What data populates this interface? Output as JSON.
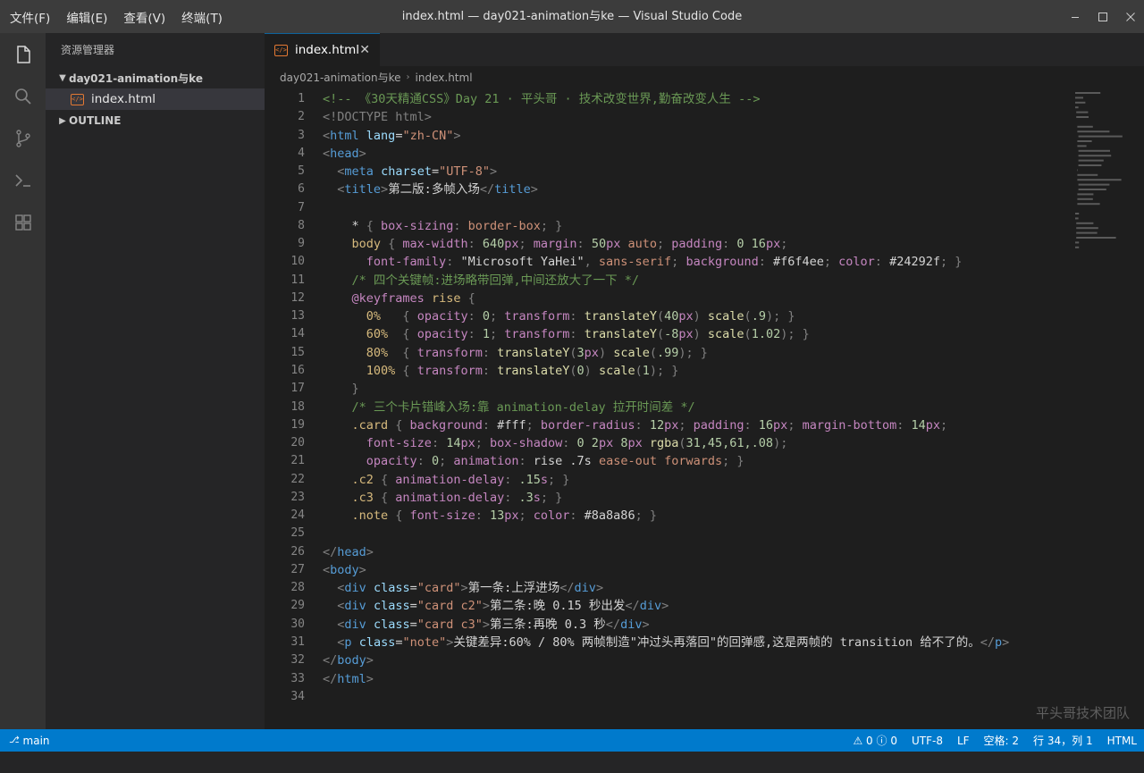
{
  "menu": [
    "文件(F)",
    "编辑(E)",
    "查看(V)",
    "终端(T)"
  ],
  "window_title": "index.html — day021-animation与ke — Visual Studio Code",
  "sidebar": {
    "title": "资源管理器",
    "folder": "day021-animation与ke",
    "file": "index.html",
    "outline": "OUTLINE"
  },
  "tab": {
    "label": "index.html"
  },
  "breadcrumb": {
    "folder": "day021-animation与ke",
    "file": "index.html"
  },
  "code_lines": [
    [
      [
        "#6a9955",
        "<!-- 《30天精通CSS》Day 21 · 平头哥 · 技术改变世界,勤奋改变人生 -->"
      ]
    ],
    [
      [
        "#808080",
        "<!DOCTYPE html>"
      ]
    ],
    [
      [
        "#808080",
        "<"
      ],
      [
        "#569cd6",
        "html"
      ],
      [
        "#d4d4d4",
        " "
      ],
      [
        "#9cdcfe",
        "lang"
      ],
      [
        "#d4d4d4",
        "="
      ],
      [
        "#ce9178",
        "\"zh-CN\""
      ],
      [
        "#808080",
        ">"
      ]
    ],
    [
      [
        "#808080",
        "<"
      ],
      [
        "#569cd6",
        "head"
      ],
      [
        "#808080",
        ">"
      ]
    ],
    [
      [
        "#d4d4d4",
        "  "
      ],
      [
        "#808080",
        "<"
      ],
      [
        "#569cd6",
        "meta"
      ],
      [
        "#d4d4d4",
        " "
      ],
      [
        "#9cdcfe",
        "charset"
      ],
      [
        "#d4d4d4",
        "="
      ],
      [
        "#ce9178",
        "\"UTF-8\""
      ],
      [
        "#808080",
        ">"
      ]
    ],
    [
      [
        "#d4d4d4",
        "  "
      ],
      [
        "#808080",
        "<"
      ],
      [
        "#569cd6",
        "title"
      ],
      [
        "#808080",
        ">"
      ],
      [
        "#d4d4d4",
        "第二版:多帧入场"
      ],
      [
        "#808080",
        "</"
      ],
      [
        "#569cd6",
        "title"
      ],
      [
        "#808080",
        ">"
      ]
    ],
    [],
    [
      [
        "#d4d4d4",
        "    * "
      ],
      [
        "#808080",
        "{ "
      ],
      [
        "#c586c0",
        "box-sizing"
      ],
      [
        "#808080",
        ": "
      ],
      [
        "#ce9178",
        "border-box"
      ],
      [
        "#808080",
        "; }"
      ]
    ],
    [
      [
        "#d4d4d4",
        "    "
      ],
      [
        "#d7ba7d",
        "body"
      ],
      [
        "#808080",
        " { "
      ],
      [
        "#c586c0",
        "max-width"
      ],
      [
        "#808080",
        ": "
      ],
      [
        "#b5cea8",
        "640"
      ],
      [
        "#c586c0",
        "px"
      ],
      [
        "#808080",
        "; "
      ],
      [
        "#c586c0",
        "margin"
      ],
      [
        "#808080",
        ": "
      ],
      [
        "#b5cea8",
        "50"
      ],
      [
        "#c586c0",
        "px"
      ],
      [
        "#ce9178",
        " auto"
      ],
      [
        "#808080",
        "; "
      ],
      [
        "#c586c0",
        "padding"
      ],
      [
        "#808080",
        ": "
      ],
      [
        "#b5cea8",
        "0 16"
      ],
      [
        "#c586c0",
        "px"
      ],
      [
        "#808080",
        ";"
      ]
    ],
    [
      [
        "#d4d4d4",
        "      "
      ],
      [
        "#c586c0",
        "font-family"
      ],
      [
        "#808080",
        ": "
      ],
      [
        "#d4d4d4",
        "\"Microsoft YaHei\""
      ],
      [
        "#808080",
        ", "
      ],
      [
        "#ce9178",
        "sans-serif"
      ],
      [
        "#808080",
        "; "
      ],
      [
        "#c586c0",
        "background"
      ],
      [
        "#808080",
        ": "
      ],
      [
        "#d4d4d4",
        "#f6f4ee"
      ],
      [
        "#808080",
        "; "
      ],
      [
        "#c586c0",
        "color"
      ],
      [
        "#808080",
        ": "
      ],
      [
        "#d4d4d4",
        "#24292f"
      ],
      [
        "#808080",
        "; }"
      ]
    ],
    [
      [
        "#d4d4d4",
        "    "
      ],
      [
        "#6a9955",
        "/* 四个关键帧:进场略带回弹,中间还放大了一下 */"
      ]
    ],
    [
      [
        "#d4d4d4",
        "    "
      ],
      [
        "#c586c0",
        "@keyframes"
      ],
      [
        "#d4d4d4",
        " "
      ],
      [
        "#d7ba7d",
        "rise"
      ],
      [
        "#808080",
        " {"
      ]
    ],
    [
      [
        "#d4d4d4",
        "      "
      ],
      [
        "#d7ba7d",
        "0%"
      ],
      [
        "#808080",
        "   { "
      ],
      [
        "#c586c0",
        "opacity"
      ],
      [
        "#808080",
        ": "
      ],
      [
        "#b5cea8",
        "0"
      ],
      [
        "#808080",
        "; "
      ],
      [
        "#c586c0",
        "transform"
      ],
      [
        "#808080",
        ": "
      ],
      [
        "#dcdcaa",
        "translateY"
      ],
      [
        "#808080",
        "("
      ],
      [
        "#b5cea8",
        "40"
      ],
      [
        "#c586c0",
        "px"
      ],
      [
        "#808080",
        ") "
      ],
      [
        "#dcdcaa",
        "scale"
      ],
      [
        "#808080",
        "("
      ],
      [
        "#b5cea8",
        ".9"
      ],
      [
        "#808080",
        "); }"
      ]
    ],
    [
      [
        "#d4d4d4",
        "      "
      ],
      [
        "#d7ba7d",
        "60%"
      ],
      [
        "#808080",
        "  { "
      ],
      [
        "#c586c0",
        "opacity"
      ],
      [
        "#808080",
        ": "
      ],
      [
        "#b5cea8",
        "1"
      ],
      [
        "#808080",
        "; "
      ],
      [
        "#c586c0",
        "transform"
      ],
      [
        "#808080",
        ": "
      ],
      [
        "#dcdcaa",
        "translateY"
      ],
      [
        "#808080",
        "("
      ],
      [
        "#b5cea8",
        "-8"
      ],
      [
        "#c586c0",
        "px"
      ],
      [
        "#808080",
        ") "
      ],
      [
        "#dcdcaa",
        "scale"
      ],
      [
        "#808080",
        "("
      ],
      [
        "#b5cea8",
        "1.02"
      ],
      [
        "#808080",
        "); }"
      ]
    ],
    [
      [
        "#d4d4d4",
        "      "
      ],
      [
        "#d7ba7d",
        "80%"
      ],
      [
        "#808080",
        "  { "
      ],
      [
        "#c586c0",
        "transform"
      ],
      [
        "#808080",
        ": "
      ],
      [
        "#dcdcaa",
        "translateY"
      ],
      [
        "#808080",
        "("
      ],
      [
        "#b5cea8",
        "3"
      ],
      [
        "#c586c0",
        "px"
      ],
      [
        "#808080",
        ") "
      ],
      [
        "#dcdcaa",
        "scale"
      ],
      [
        "#808080",
        "("
      ],
      [
        "#b5cea8",
        ".99"
      ],
      [
        "#808080",
        "); }"
      ]
    ],
    [
      [
        "#d4d4d4",
        "      "
      ],
      [
        "#d7ba7d",
        "100%"
      ],
      [
        "#808080",
        " { "
      ],
      [
        "#c586c0",
        "transform"
      ],
      [
        "#808080",
        ": "
      ],
      [
        "#dcdcaa",
        "translateY"
      ],
      [
        "#808080",
        "("
      ],
      [
        "#b5cea8",
        "0"
      ],
      [
        "#808080",
        ") "
      ],
      [
        "#dcdcaa",
        "scale"
      ],
      [
        "#808080",
        "("
      ],
      [
        "#b5cea8",
        "1"
      ],
      [
        "#808080",
        "); }"
      ]
    ],
    [
      [
        "#808080",
        "    }"
      ]
    ],
    [
      [
        "#d4d4d4",
        "    "
      ],
      [
        "#6a9955",
        "/* 三个卡片错峰入场:靠 animation-delay 拉开时间差 */"
      ]
    ],
    [
      [
        "#d4d4d4",
        "    "
      ],
      [
        "#d7ba7d",
        ".card"
      ],
      [
        "#808080",
        " { "
      ],
      [
        "#c586c0",
        "background"
      ],
      [
        "#808080",
        ": "
      ],
      [
        "#d4d4d4",
        "#fff"
      ],
      [
        "#808080",
        "; "
      ],
      [
        "#c586c0",
        "border-radius"
      ],
      [
        "#808080",
        ": "
      ],
      [
        "#b5cea8",
        "12"
      ],
      [
        "#c586c0",
        "px"
      ],
      [
        "#808080",
        "; "
      ],
      [
        "#c586c0",
        "padding"
      ],
      [
        "#808080",
        ": "
      ],
      [
        "#b5cea8",
        "16"
      ],
      [
        "#c586c0",
        "px"
      ],
      [
        "#808080",
        "; "
      ],
      [
        "#c586c0",
        "margin-bottom"
      ],
      [
        "#808080",
        ": "
      ],
      [
        "#b5cea8",
        "14"
      ],
      [
        "#c586c0",
        "px"
      ],
      [
        "#808080",
        ";"
      ]
    ],
    [
      [
        "#d4d4d4",
        "      "
      ],
      [
        "#c586c0",
        "font-size"
      ],
      [
        "#808080",
        ": "
      ],
      [
        "#b5cea8",
        "14"
      ],
      [
        "#c586c0",
        "px"
      ],
      [
        "#808080",
        "; "
      ],
      [
        "#c586c0",
        "box-shadow"
      ],
      [
        "#808080",
        ": "
      ],
      [
        "#b5cea8",
        "0 2"
      ],
      [
        "#c586c0",
        "px"
      ],
      [
        "#b5cea8",
        " 8"
      ],
      [
        "#c586c0",
        "px"
      ],
      [
        "#d4d4d4",
        " "
      ],
      [
        "#dcdcaa",
        "rgba"
      ],
      [
        "#808080",
        "("
      ],
      [
        "#b5cea8",
        "31,45,61,.08"
      ],
      [
        "#808080",
        ");"
      ]
    ],
    [
      [
        "#d4d4d4",
        "      "
      ],
      [
        "#c586c0",
        "opacity"
      ],
      [
        "#808080",
        ": "
      ],
      [
        "#b5cea8",
        "0"
      ],
      [
        "#808080",
        "; "
      ],
      [
        "#c586c0",
        "animation"
      ],
      [
        "#808080",
        ": "
      ],
      [
        "#d4d4d4",
        "rise .7s "
      ],
      [
        "#ce9178",
        "ease-out forwards"
      ],
      [
        "#808080",
        "; }"
      ]
    ],
    [
      [
        "#d4d4d4",
        "    "
      ],
      [
        "#d7ba7d",
        ".c2"
      ],
      [
        "#808080",
        " { "
      ],
      [
        "#c586c0",
        "animation-delay"
      ],
      [
        "#808080",
        ": "
      ],
      [
        "#b5cea8",
        ".15"
      ],
      [
        "#c586c0",
        "s"
      ],
      [
        "#808080",
        "; }"
      ]
    ],
    [
      [
        "#d4d4d4",
        "    "
      ],
      [
        "#d7ba7d",
        ".c3"
      ],
      [
        "#808080",
        " { "
      ],
      [
        "#c586c0",
        "animation-delay"
      ],
      [
        "#808080",
        ": "
      ],
      [
        "#b5cea8",
        ".3"
      ],
      [
        "#c586c0",
        "s"
      ],
      [
        "#808080",
        "; }"
      ]
    ],
    [
      [
        "#d4d4d4",
        "    "
      ],
      [
        "#d7ba7d",
        ".note"
      ],
      [
        "#808080",
        " { "
      ],
      [
        "#c586c0",
        "font-size"
      ],
      [
        "#808080",
        ": "
      ],
      [
        "#b5cea8",
        "13"
      ],
      [
        "#c586c0",
        "px"
      ],
      [
        "#808080",
        "; "
      ],
      [
        "#c586c0",
        "color"
      ],
      [
        "#808080",
        ": "
      ],
      [
        "#d4d4d4",
        "#8a8a86"
      ],
      [
        "#808080",
        "; }"
      ]
    ],
    [],
    [
      [
        "#808080",
        "</"
      ],
      [
        "#569cd6",
        "head"
      ],
      [
        "#808080",
        ">"
      ]
    ],
    [
      [
        "#808080",
        "<"
      ],
      [
        "#569cd6",
        "body"
      ],
      [
        "#808080",
        ">"
      ]
    ],
    [
      [
        "#d4d4d4",
        "  "
      ],
      [
        "#808080",
        "<"
      ],
      [
        "#569cd6",
        "div"
      ],
      [
        "#d4d4d4",
        " "
      ],
      [
        "#9cdcfe",
        "class"
      ],
      [
        "#d4d4d4",
        "="
      ],
      [
        "#ce9178",
        "\"card\""
      ],
      [
        "#808080",
        ">"
      ],
      [
        "#d4d4d4",
        "第一条:上浮进场"
      ],
      [
        "#808080",
        "</"
      ],
      [
        "#569cd6",
        "div"
      ],
      [
        "#808080",
        ">"
      ]
    ],
    [
      [
        "#d4d4d4",
        "  "
      ],
      [
        "#808080",
        "<"
      ],
      [
        "#569cd6",
        "div"
      ],
      [
        "#d4d4d4",
        " "
      ],
      [
        "#9cdcfe",
        "class"
      ],
      [
        "#d4d4d4",
        "="
      ],
      [
        "#ce9178",
        "\"card c2\""
      ],
      [
        "#808080",
        ">"
      ],
      [
        "#d4d4d4",
        "第二条:晚 0.15 秒出发"
      ],
      [
        "#808080",
        "</"
      ],
      [
        "#569cd6",
        "div"
      ],
      [
        "#808080",
        ">"
      ]
    ],
    [
      [
        "#d4d4d4",
        "  "
      ],
      [
        "#808080",
        "<"
      ],
      [
        "#569cd6",
        "div"
      ],
      [
        "#d4d4d4",
        " "
      ],
      [
        "#9cdcfe",
        "class"
      ],
      [
        "#d4d4d4",
        "="
      ],
      [
        "#ce9178",
        "\"card c3\""
      ],
      [
        "#808080",
        ">"
      ],
      [
        "#d4d4d4",
        "第三条:再晚 0.3 秒"
      ],
      [
        "#808080",
        "</"
      ],
      [
        "#569cd6",
        "div"
      ],
      [
        "#808080",
        ">"
      ]
    ],
    [
      [
        "#d4d4d4",
        "  "
      ],
      [
        "#808080",
        "<"
      ],
      [
        "#569cd6",
        "p"
      ],
      [
        "#d4d4d4",
        " "
      ],
      [
        "#9cdcfe",
        "class"
      ],
      [
        "#d4d4d4",
        "="
      ],
      [
        "#ce9178",
        "\"note\""
      ],
      [
        "#808080",
        ">"
      ],
      [
        "#d4d4d4",
        "关键差异:60% / 80% 两帧制造\"冲过头再落回\"的回弹感,这是两帧的 transition 给不了的。"
      ],
      [
        "#808080",
        "</"
      ],
      [
        "#569cd6",
        "p"
      ],
      [
        "#808080",
        ">"
      ]
    ],
    [
      [
        "#808080",
        "</"
      ],
      [
        "#569cd6",
        "body"
      ],
      [
        "#808080",
        ">"
      ]
    ],
    [
      [
        "#808080",
        "</"
      ],
      [
        "#569cd6",
        "html"
      ],
      [
        "#808080",
        ">"
      ]
    ],
    []
  ],
  "watermark": "平头哥技术团队",
  "status": {
    "branch": "main",
    "problems": "⚠ 0  ⓘ 0",
    "encoding": "UTF-8",
    "eol": "LF",
    "indent": "空格: 2",
    "position": "行 34，列 1",
    "language": "HTML"
  },
  "colors": {
    "accent": "#007acc",
    "html_icon": "#e37933",
    "comment": "#6a9955",
    "tag": "#569cd6",
    "string": "#ce9178"
  },
  "icons": [
    "files-icon",
    "search-icon",
    "source-control-icon",
    "terminal-icon",
    "extensions-icon"
  ]
}
